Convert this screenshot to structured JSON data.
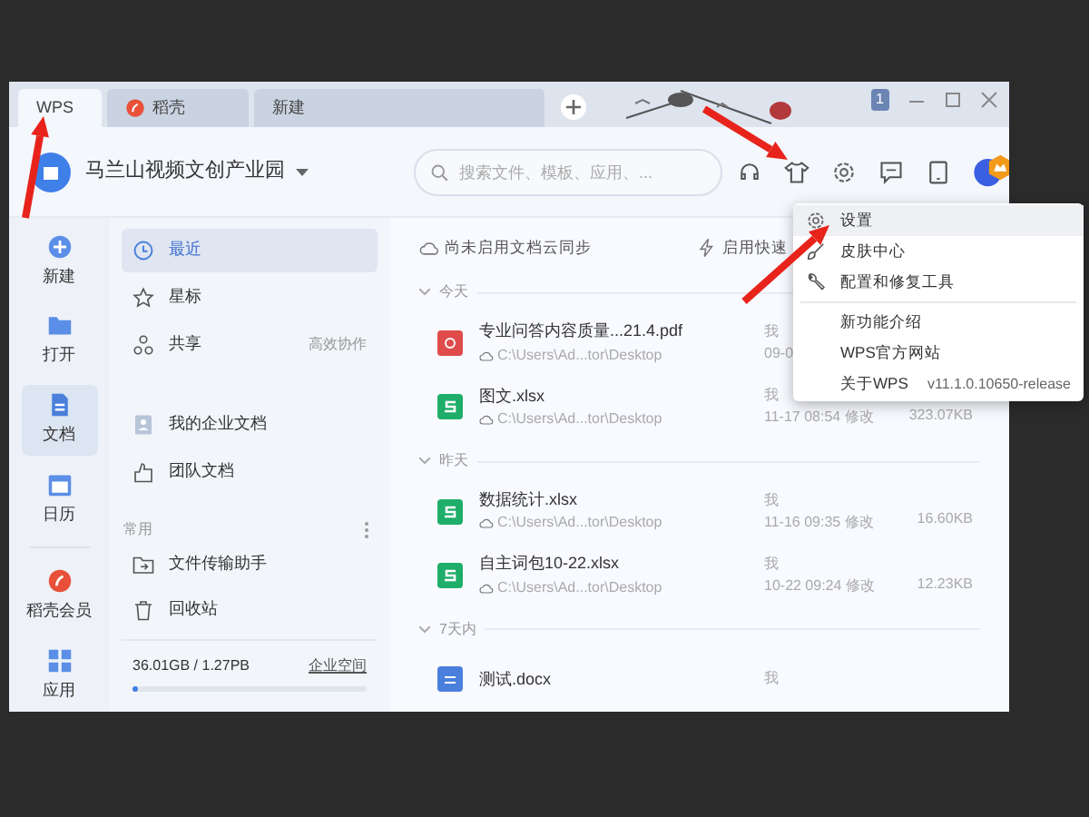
{
  "tabs": [
    {
      "label": "WPS",
      "selected": true,
      "kind": "home"
    },
    {
      "label": "稻壳",
      "selected": false,
      "kind": "docer"
    },
    {
      "label": "新建",
      "selected": false,
      "kind": "plain"
    }
  ],
  "title_badge": "1",
  "header": {
    "workspace": "马兰山视频文创产业园",
    "search_placeholder": "搜索文件、模板、应用、..."
  },
  "rail": [
    {
      "label": "新建",
      "kind": "plus",
      "selected": false
    },
    {
      "label": "打开",
      "kind": "folder",
      "selected": false
    },
    {
      "label": "文档",
      "kind": "doc",
      "selected": true
    },
    {
      "label": "日历",
      "kind": "calendar",
      "selected": false
    },
    {
      "label": "稻壳会员",
      "kind": "docer",
      "selected": false
    },
    {
      "label": "应用",
      "kind": "apps",
      "selected": false
    }
  ],
  "nav": {
    "items": [
      {
        "label": "最近",
        "kind": "clock",
        "selected": true
      },
      {
        "label": "星标",
        "kind": "star",
        "selected": false
      },
      {
        "label": "共享",
        "kind": "share",
        "selected": false,
        "note": "高效协作"
      },
      {
        "label": "我的企业文档",
        "kind": "person",
        "selected": false,
        "gap": true
      },
      {
        "label": "团队文档",
        "kind": "team",
        "selected": false
      }
    ],
    "section": "常用",
    "common": [
      {
        "label": "文件传输助手",
        "kind": "transfer"
      },
      {
        "label": "回收站",
        "kind": "trash"
      }
    ],
    "storage": {
      "usage": "36.01GB / 1.27PB",
      "link": "企业空间",
      "level": 0.02
    }
  },
  "toolbar": {
    "sync": "尚未启用文档云同步",
    "quick": "启用快速"
  },
  "groups": [
    {
      "title": "今天",
      "files": [
        {
          "name": "专业问答内容质量...21.4.pdf",
          "kind": "pdf",
          "path": "C:\\Users\\Ad...tor\\Desktop",
          "owner": "我",
          "time": "09-0"
        },
        {
          "name": "图文.xlsx",
          "kind": "xlsx",
          "path": "C:\\Users\\Ad...tor\\Desktop",
          "owner": "我",
          "time": "11-17 08:54 修改",
          "size": "323.07KB"
        }
      ]
    },
    {
      "title": "昨天",
      "files": [
        {
          "name": "数据统计.xlsx",
          "kind": "xlsx",
          "path": "C:\\Users\\Ad...tor\\Desktop",
          "owner": "我",
          "time": "11-16 09:35 修改",
          "size": "16.60KB"
        },
        {
          "name": "自主词包10-22.xlsx",
          "kind": "xlsx",
          "path": "C:\\Users\\Ad...tor\\Desktop",
          "owner": "我",
          "time": "10-22 09:24 修改",
          "size": "12.23KB"
        }
      ]
    },
    {
      "title": "7天内",
      "files": [
        {
          "name": "测试.docx",
          "kind": "docx",
          "owner": "我"
        }
      ]
    }
  ],
  "menu": [
    {
      "label": "设置",
      "kind": "gear",
      "selected": true
    },
    {
      "label": "皮肤中心",
      "kind": "brush",
      "selected": false
    },
    {
      "label": "配置和修复工具",
      "kind": "wrench",
      "selected": false,
      "divider": true
    },
    {
      "label": "新功能介绍",
      "kind": "plain",
      "selected": false
    },
    {
      "label": "WPS官方网站",
      "kind": "plain",
      "selected": false
    },
    {
      "label": "关于WPS",
      "kind": "plain",
      "selected": false,
      "version": "v11.1.0.10650-release"
    }
  ]
}
